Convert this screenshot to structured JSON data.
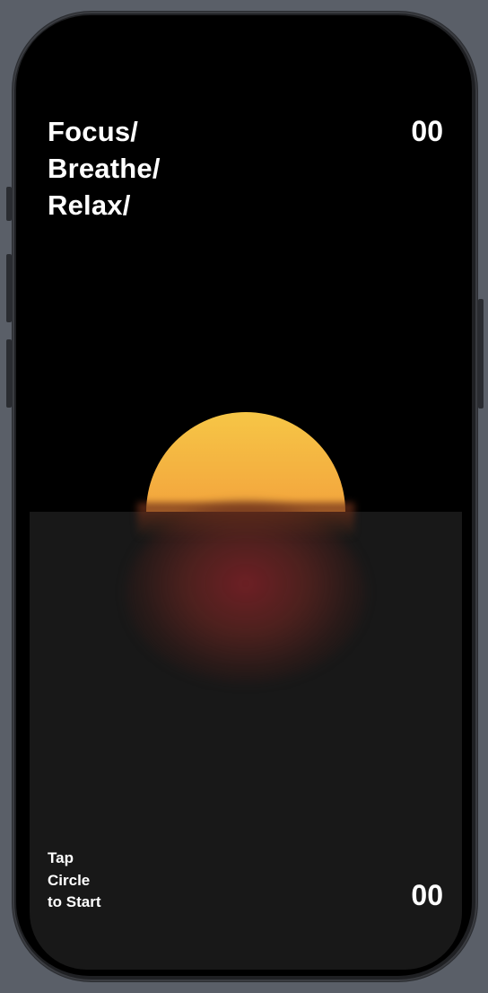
{
  "title": {
    "line1": "Focus/",
    "line2": "Breathe/",
    "line3": "Relax/"
  },
  "counters": {
    "top": "00",
    "bottom": "00"
  },
  "hint": {
    "line1": "Tap",
    "line2": "Circle",
    "line3": "to Start"
  },
  "colors": {
    "background": "#000000",
    "ground": "#181818",
    "sun_top": "#f6c646",
    "sun_bottom": "#ee7a33",
    "reflection": "#782026",
    "text": "#ffffff"
  }
}
